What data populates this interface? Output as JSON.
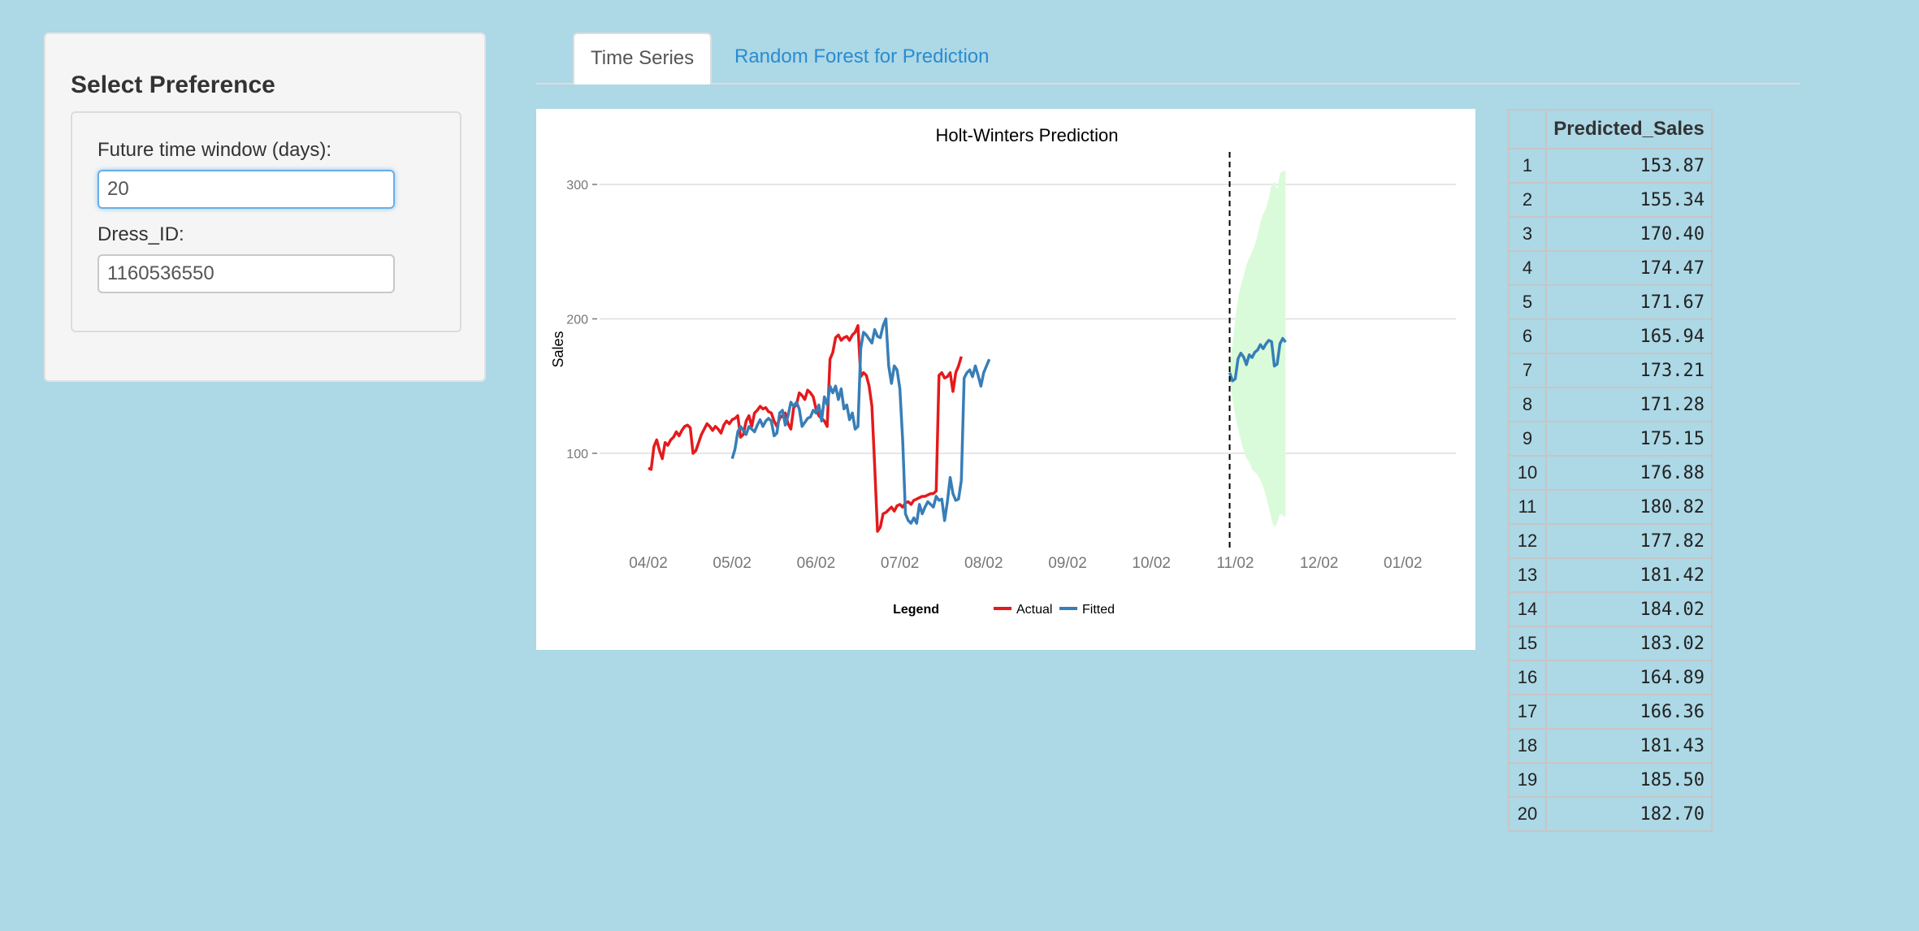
{
  "sidebar": {
    "title": "Select Preference",
    "window_label": "Future time window (days):",
    "window_value": "20",
    "dress_label": "Dress_ID:",
    "dress_value": "1160536550"
  },
  "tabs": [
    {
      "label": "Time Series",
      "active": true
    },
    {
      "label": "Random Forest for Prediction",
      "active": false
    }
  ],
  "chart_data": {
    "type": "line",
    "title": "Holt-Winters Prediction",
    "ylabel": "Sales",
    "xlabel": "",
    "ylim": [
      30,
      310
    ],
    "yticks": [
      100,
      200,
      300
    ],
    "xticks": [
      "04/02",
      "05/02",
      "06/02",
      "07/02",
      "08/02",
      "09/02",
      "10/02",
      "11/02",
      "12/02",
      "01/02"
    ],
    "x_unit": "day index starting 04/02",
    "tick_days": [
      0,
      30,
      60,
      90,
      120,
      150,
      180,
      210,
      240,
      270
    ],
    "forecast_start_day": 208,
    "legend_title": "Legend",
    "legend_position": "bottom",
    "series": [
      {
        "name": "Actual",
        "color": "#e41a1c",
        "start_day": 0,
        "values": [
          89,
          88,
          105,
          110,
          102,
          96,
          108,
          106,
          110,
          112,
          116,
          113,
          117,
          120,
          121,
          119,
          100,
          102,
          108,
          114,
          118,
          122,
          120,
          117,
          120,
          118,
          115,
          121,
          124,
          122,
          125,
          126,
          128,
          112,
          114,
          124,
          128,
          120,
          130,
          132,
          135,
          133,
          134,
          131,
          130,
          124,
          120,
          126,
          128,
          130,
          122,
          118,
          134,
          136,
          145,
          143,
          140,
          147,
          145,
          142,
          133,
          128,
          126,
          124,
          120,
          170,
          175,
          186,
          188,
          184,
          186,
          187,
          184,
          188,
          190,
          195,
          157,
          160,
          158,
          150,
          135,
          90,
          42,
          45,
          55,
          56,
          58,
          60,
          57,
          61,
          62,
          60,
          63,
          64,
          62,
          65,
          66,
          67,
          68,
          68,
          69,
          70,
          70,
          72,
          158,
          160,
          156,
          157,
          160,
          146,
          160,
          165,
          172
        ]
      },
      {
        "name": "Fitted",
        "color": "#377eb8",
        "start_day": 30,
        "values": [
          96,
          103,
          116,
          120,
          117,
          114,
          120,
          118,
          116,
          121,
          125,
          120,
          124,
          126,
          124,
          113,
          115,
          130,
          132,
          121,
          128,
          138,
          135,
          138,
          133,
          120,
          123,
          126,
          127,
          132,
          130,
          136,
          124,
          142,
          136,
          150,
          145,
          150,
          140,
          148,
          133,
          136,
          125,
          130,
          118,
          120,
          178,
          190,
          188,
          185,
          182,
          192,
          187,
          186,
          195,
          200,
          165,
          152,
          165,
          162,
          148,
          110,
          55,
          50,
          48,
          52,
          48,
          62,
          55,
          60,
          64,
          62,
          60,
          68,
          65,
          66,
          50,
          64,
          82,
          70,
          65,
          66,
          80,
          156,
          160,
          162,
          157,
          165,
          158,
          150,
          160,
          165,
          170
        ]
      },
      {
        "name": "Forecast",
        "color": "#377eb8",
        "start_day": 208,
        "values": [
          160,
          153.87,
          155.34,
          170.4,
          174.47,
          171.67,
          165.94,
          173.21,
          171.28,
          175.15,
          176.88,
          180.82,
          177.82,
          181.42,
          184.02,
          183.02,
          164.89,
          166.36,
          181.43,
          185.5,
          182.7
        ]
      }
    ],
    "band": {
      "color": "#dafbd9",
      "start_day": 208,
      "upper": [
        165,
        180,
        200,
        215,
        225,
        232,
        240,
        245,
        250,
        255,
        262,
        272,
        278,
        282,
        290,
        300,
        302,
        296,
        308,
        310,
        310
      ],
      "lower": [
        155,
        140,
        128,
        118,
        110,
        102,
        96,
        94,
        88,
        86,
        84,
        80,
        75,
        68,
        60,
        50,
        45,
        48,
        55,
        54,
        52
      ]
    }
  },
  "table": {
    "header": "Predicted_Sales",
    "rows": [
      {
        "i": "1",
        "v": "153.87"
      },
      {
        "i": "2",
        "v": "155.34"
      },
      {
        "i": "3",
        "v": "170.40"
      },
      {
        "i": "4",
        "v": "174.47"
      },
      {
        "i": "5",
        "v": "171.67"
      },
      {
        "i": "6",
        "v": "165.94"
      },
      {
        "i": "7",
        "v": "173.21"
      },
      {
        "i": "8",
        "v": "171.28"
      },
      {
        "i": "9",
        "v": "175.15"
      },
      {
        "i": "10",
        "v": "176.88"
      },
      {
        "i": "11",
        "v": "180.82"
      },
      {
        "i": "12",
        "v": "177.82"
      },
      {
        "i": "13",
        "v": "181.42"
      },
      {
        "i": "14",
        "v": "184.02"
      },
      {
        "i": "15",
        "v": "183.02"
      },
      {
        "i": "16",
        "v": "164.89"
      },
      {
        "i": "17",
        "v": "166.36"
      },
      {
        "i": "18",
        "v": "181.43"
      },
      {
        "i": "19",
        "v": "185.50"
      },
      {
        "i": "20",
        "v": "182.70"
      }
    ]
  }
}
